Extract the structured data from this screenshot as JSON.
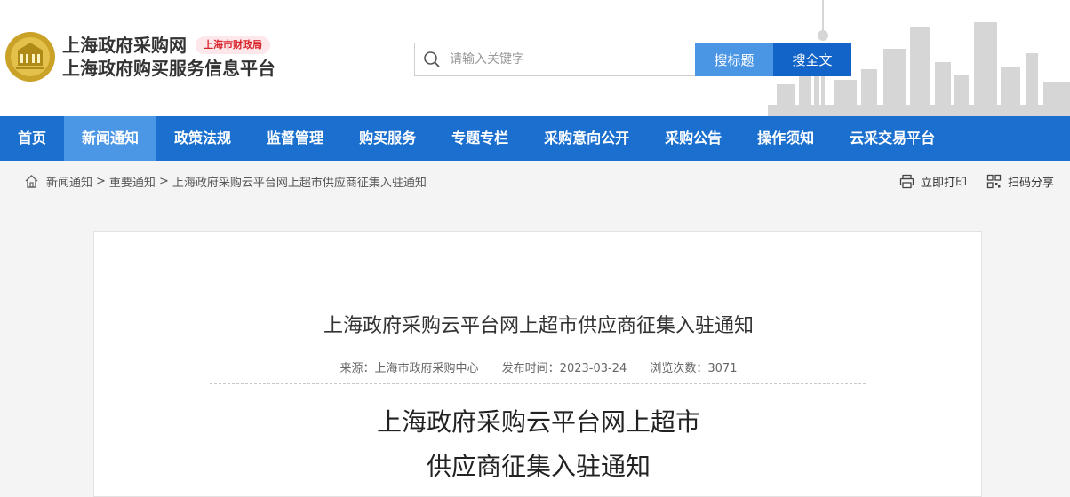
{
  "header": {
    "site_name": "上海政府采购网",
    "bureau_badge": "上海市财政局",
    "platform_name": "上海政府购买服务信息平台"
  },
  "search": {
    "placeholder": "请输入关键字",
    "title_button": "搜标题",
    "fulltext_button": "搜全文"
  },
  "nav": {
    "items": [
      "首页",
      "新闻通知",
      "政策法规",
      "监督管理",
      "购买服务",
      "专题专栏",
      "采购意向公开",
      "采购公告",
      "操作须知",
      "云采交易平台"
    ],
    "active": "新闻通知"
  },
  "breadcrumb": {
    "items": [
      "新闻通知",
      "重要通知",
      "上海政府采购云平台网上超市供应商征集入驻通知"
    ],
    "separator": ">"
  },
  "tools": {
    "print": "立即打印",
    "share": "扫码分享"
  },
  "article": {
    "title": "上海政府采购云平台网上超市供应商征集入驻通知",
    "source": "来源：上海市政府采购中心",
    "publish_time": "发布时间：2023-03-24",
    "views": "浏览次数：3071",
    "body_title_line1": "上海政府采购云平台网上超市",
    "body_title_line2": "供应商征集入驻通知"
  },
  "colors": {
    "nav_bg": "#1a6fcf",
    "nav_active": "#4b96e5",
    "search_title_btn": "#4a95e4",
    "search_full_btn": "#1264c8",
    "badge_text": "#d9242c"
  }
}
